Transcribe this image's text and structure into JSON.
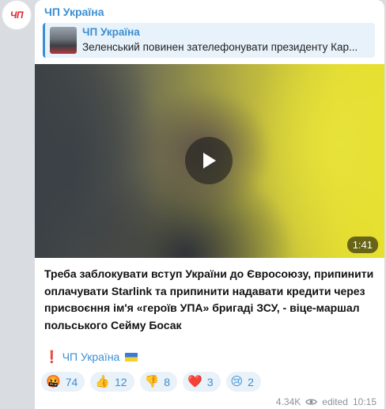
{
  "channel": {
    "avatar_text": "ЧП",
    "name": "ЧП Україна"
  },
  "reply": {
    "name": "ЧП Україна",
    "text": "Зеленський повинен зателефонувати президенту Кар..."
  },
  "video": {
    "duration": "1:41"
  },
  "post": {
    "caption": "Треба заблокувати вступ України до Євросоюзу, припинити оплачувати Starlink та припинити надавати кредити через присвоєння ім'я «героїв УПА» бригаді ЗСУ, - віце-маршал польського Сейму Босак",
    "signature_mark": "❗",
    "signature": "ЧП Україна"
  },
  "reactions": [
    {
      "emoji": "🤬",
      "icon": "angry-face-icon",
      "count": "74"
    },
    {
      "emoji": "👍",
      "icon": "thumbs-up-icon",
      "count": "12"
    },
    {
      "emoji": "👎",
      "icon": "thumbs-down-icon",
      "count": "8"
    },
    {
      "emoji": "❤️",
      "icon": "heart-icon",
      "count": "3"
    },
    {
      "emoji": "😢",
      "icon": "crying-face-icon",
      "count": "2"
    }
  ],
  "meta": {
    "views": "4.34K",
    "edited": "edited",
    "time": "10:15"
  },
  "colors": {
    "accent": "#3a8fd3",
    "reaction_bg": "#e9f1f9",
    "brand_red": "#e0242a"
  }
}
